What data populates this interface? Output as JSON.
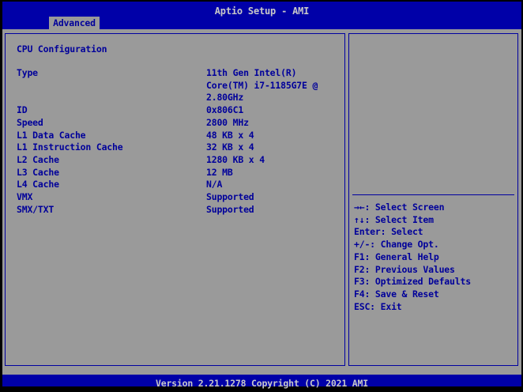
{
  "window": {
    "title": "Aptio Setup - AMI"
  },
  "tabs": [
    {
      "label": "Advanced",
      "active": true
    }
  ],
  "main": {
    "section_title": "CPU Configuration",
    "rows": [
      {
        "label": "Type",
        "value": "11th Gen Intel(R)\nCore(TM) i7-1185G7E @\n2.80GHz"
      },
      {
        "label": "ID",
        "value": "0x806C1"
      },
      {
        "label": "Speed",
        "value": "2800 MHz"
      },
      {
        "label": "L1 Data Cache",
        "value": "48 KB x 4"
      },
      {
        "label": "L1 Instruction Cache",
        "value": "32 KB x 4"
      },
      {
        "label": "L2 Cache",
        "value": "1280 KB x 4"
      },
      {
        "label": "L3 Cache",
        "value": "12 MB"
      },
      {
        "label": "L4 Cache",
        "value": "N/A"
      },
      {
        "label": "VMX",
        "value": "Supported"
      },
      {
        "label": "SMX/TXT",
        "value": "Supported"
      }
    ]
  },
  "help": {
    "items": [
      "→←: Select Screen",
      "↑↓: Select Item",
      "Enter: Select",
      "+/-: Change Opt.",
      "F1: General Help",
      "F2: Previous Values",
      "F3: Optimized Defaults",
      "F4: Save & Reset",
      "ESC: Exit"
    ]
  },
  "footer": {
    "version_text": "Version 2.21.1278 Copyright (C) 2021 AMI"
  },
  "colors": {
    "header_blue": "#0000A8",
    "panel_gray": "#9A9A9A",
    "text_blue": "#00009A",
    "light_text": "#C8C8C8",
    "border_blue": "#0000A0"
  }
}
